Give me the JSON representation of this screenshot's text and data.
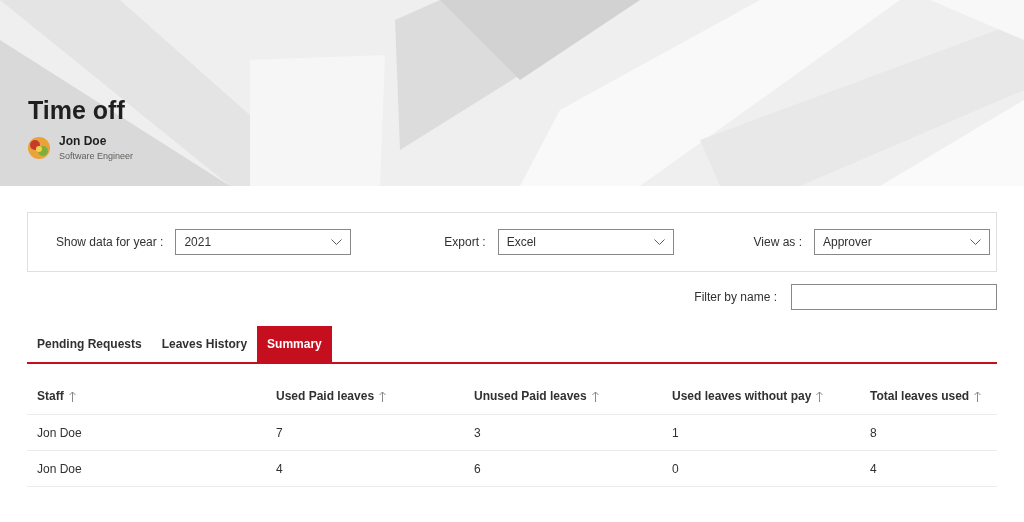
{
  "header": {
    "title": "Time off",
    "user": {
      "name": "Jon Doe",
      "role": "Software Engineer"
    }
  },
  "filters": [
    {
      "label": "Show data for year :",
      "value": "2021"
    },
    {
      "label": "Export :",
      "value": "Excel"
    },
    {
      "label": "View as :",
      "value": "Approver"
    }
  ],
  "name_filter": {
    "label": "Filter by name :"
  },
  "tabs": [
    {
      "label": "Pending Requests",
      "selected": false
    },
    {
      "label": "Leaves History",
      "selected": false
    },
    {
      "label": "Summary",
      "selected": true
    }
  ],
  "table": {
    "columns": [
      "Staff",
      "Used Paid leaves",
      "Unused Paid leaves",
      "Used leaves without pay",
      "Total leaves used"
    ],
    "rows": [
      [
        "Jon Doe",
        "7",
        "3",
        "1",
        "8"
      ],
      [
        "Jon Doe",
        "4",
        "6",
        "0",
        "4"
      ]
    ]
  }
}
